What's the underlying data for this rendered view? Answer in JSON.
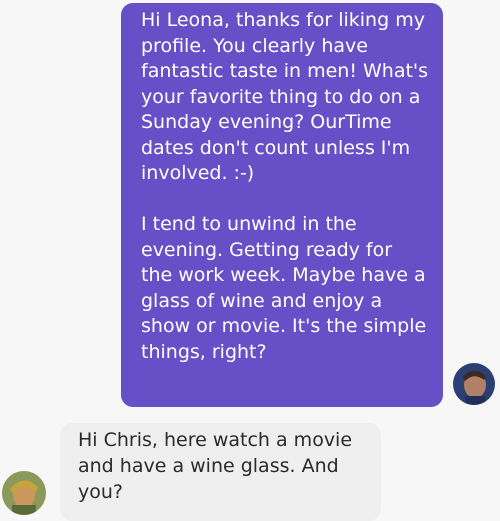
{
  "messages": {
    "sent": {
      "paragraph_1": "Hi Leona, thanks for liking my profile. You clearly have fantastic taste in men! What's your favorite thing to do on a Sunday evening? OurTime dates don't count unless I'm involved. :-)",
      "paragraph_2": "I tend to unwind in the evening. Getting ready for the work week. Maybe have a glass of wine and enjoy a show or movie. It's the simple things, right?"
    },
    "received": {
      "text": "Hi Chris, here watch a movie and have a wine glass. And you?"
    }
  },
  "icons": {
    "sent_avatar": "avatar-photo",
    "received_avatar": "avatar-photo"
  },
  "colors": {
    "sent_bubble": "#6650c7",
    "received_bubble": "#efefef",
    "background": "#f7f7f7"
  }
}
